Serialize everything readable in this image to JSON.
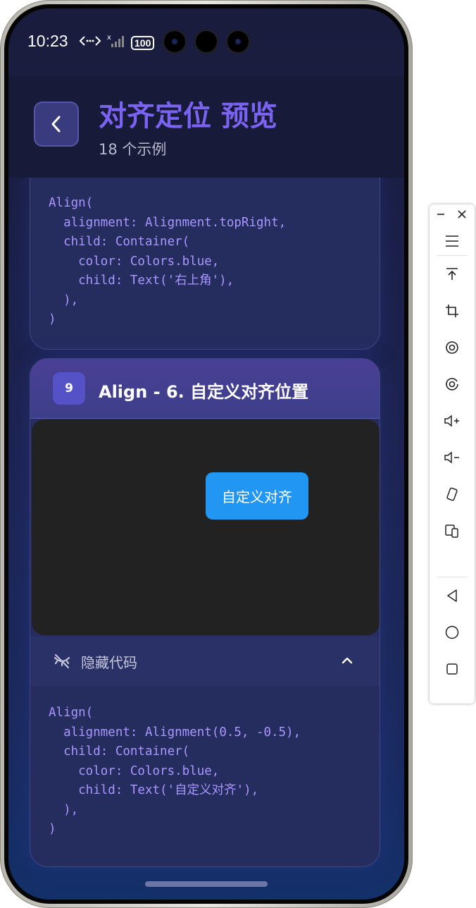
{
  "status_bar": {
    "time": "10:23",
    "battery": "100"
  },
  "header": {
    "title": "对齐定位 预览",
    "subtitle": "18 个示例"
  },
  "card_prev": {
    "code_lines": [
      "Align(",
      "  alignment: Alignment.topRight,",
      "  child: Container(",
      "    color: Colors.blue,",
      "    child: Text('右上角'),",
      "  ),",
      ")"
    ]
  },
  "card_9": {
    "number": "9",
    "title": "Align - 6. 自定义对齐位置",
    "demo_button_label": "自定义对齐",
    "toggle_label": "隐藏代码",
    "code_lines": [
      "Align(",
      "  alignment: Alignment(0.5, -0.5),",
      "  child: Container(",
      "    color: Colors.blue,",
      "    child: Text('自定义对齐'),",
      "  ),",
      ")"
    ]
  },
  "colors": {
    "accent": "#7b63f2",
    "demo_button": "#2196f3",
    "demo_bg": "#222222"
  }
}
